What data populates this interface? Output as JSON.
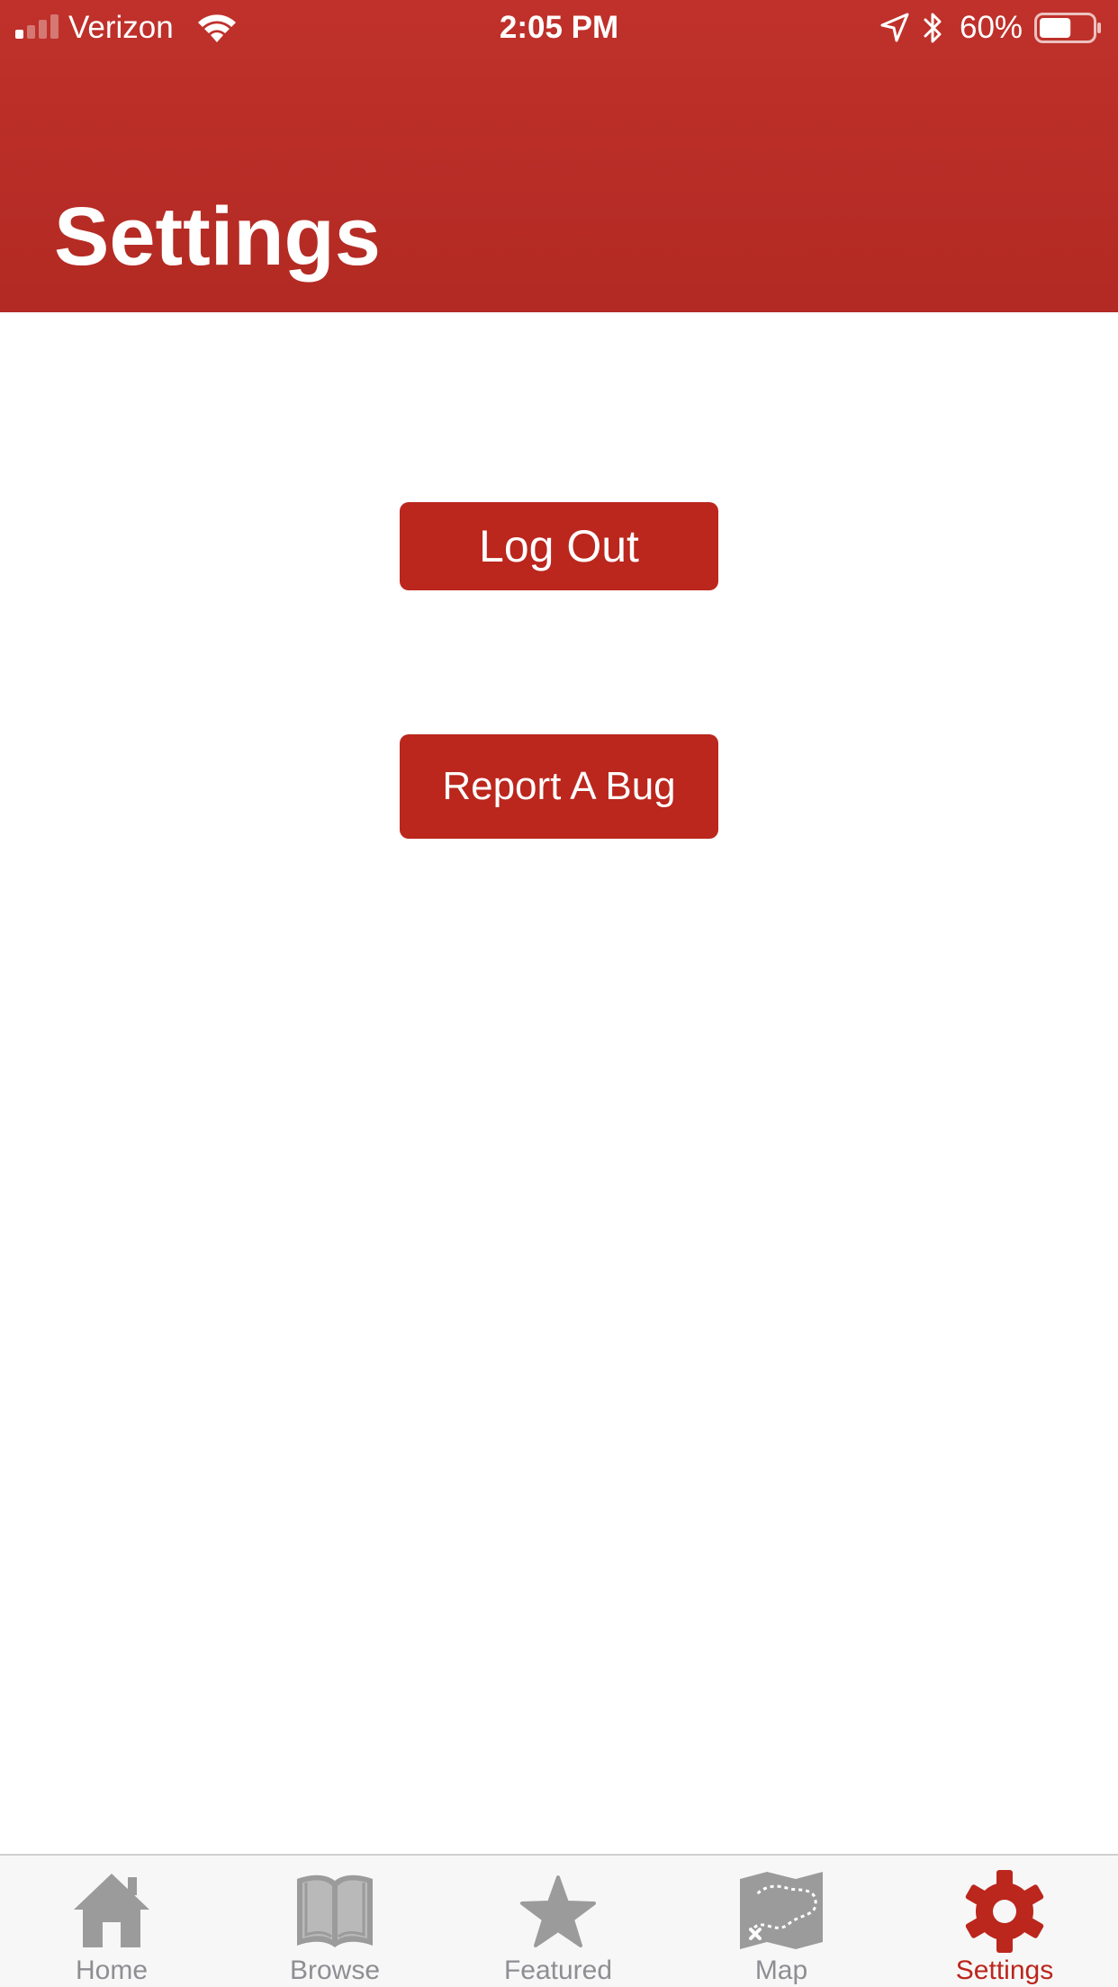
{
  "status_bar": {
    "carrier": "Verizon",
    "time": "2:05 PM",
    "battery_percent": "60%",
    "battery_level": 0.6,
    "signal_bars_filled": 1,
    "signal_bars_total": 4
  },
  "header": {
    "title": "Settings",
    "color": "#b42b24"
  },
  "actions": {
    "logout_label": "Log Out",
    "report_bug_label": "Report A Bug",
    "button_color": "#bb261d"
  },
  "tab_bar": {
    "active_color": "#bb261d",
    "inactive_color": "#8e8e93",
    "tabs": [
      {
        "label": "Home",
        "icon": "home-icon",
        "active": false
      },
      {
        "label": "Browse",
        "icon": "book-icon",
        "active": false
      },
      {
        "label": "Featured",
        "icon": "star-icon",
        "active": false
      },
      {
        "label": "Map",
        "icon": "map-icon",
        "active": false
      },
      {
        "label": "Settings",
        "icon": "gear-icon",
        "active": true
      }
    ]
  }
}
